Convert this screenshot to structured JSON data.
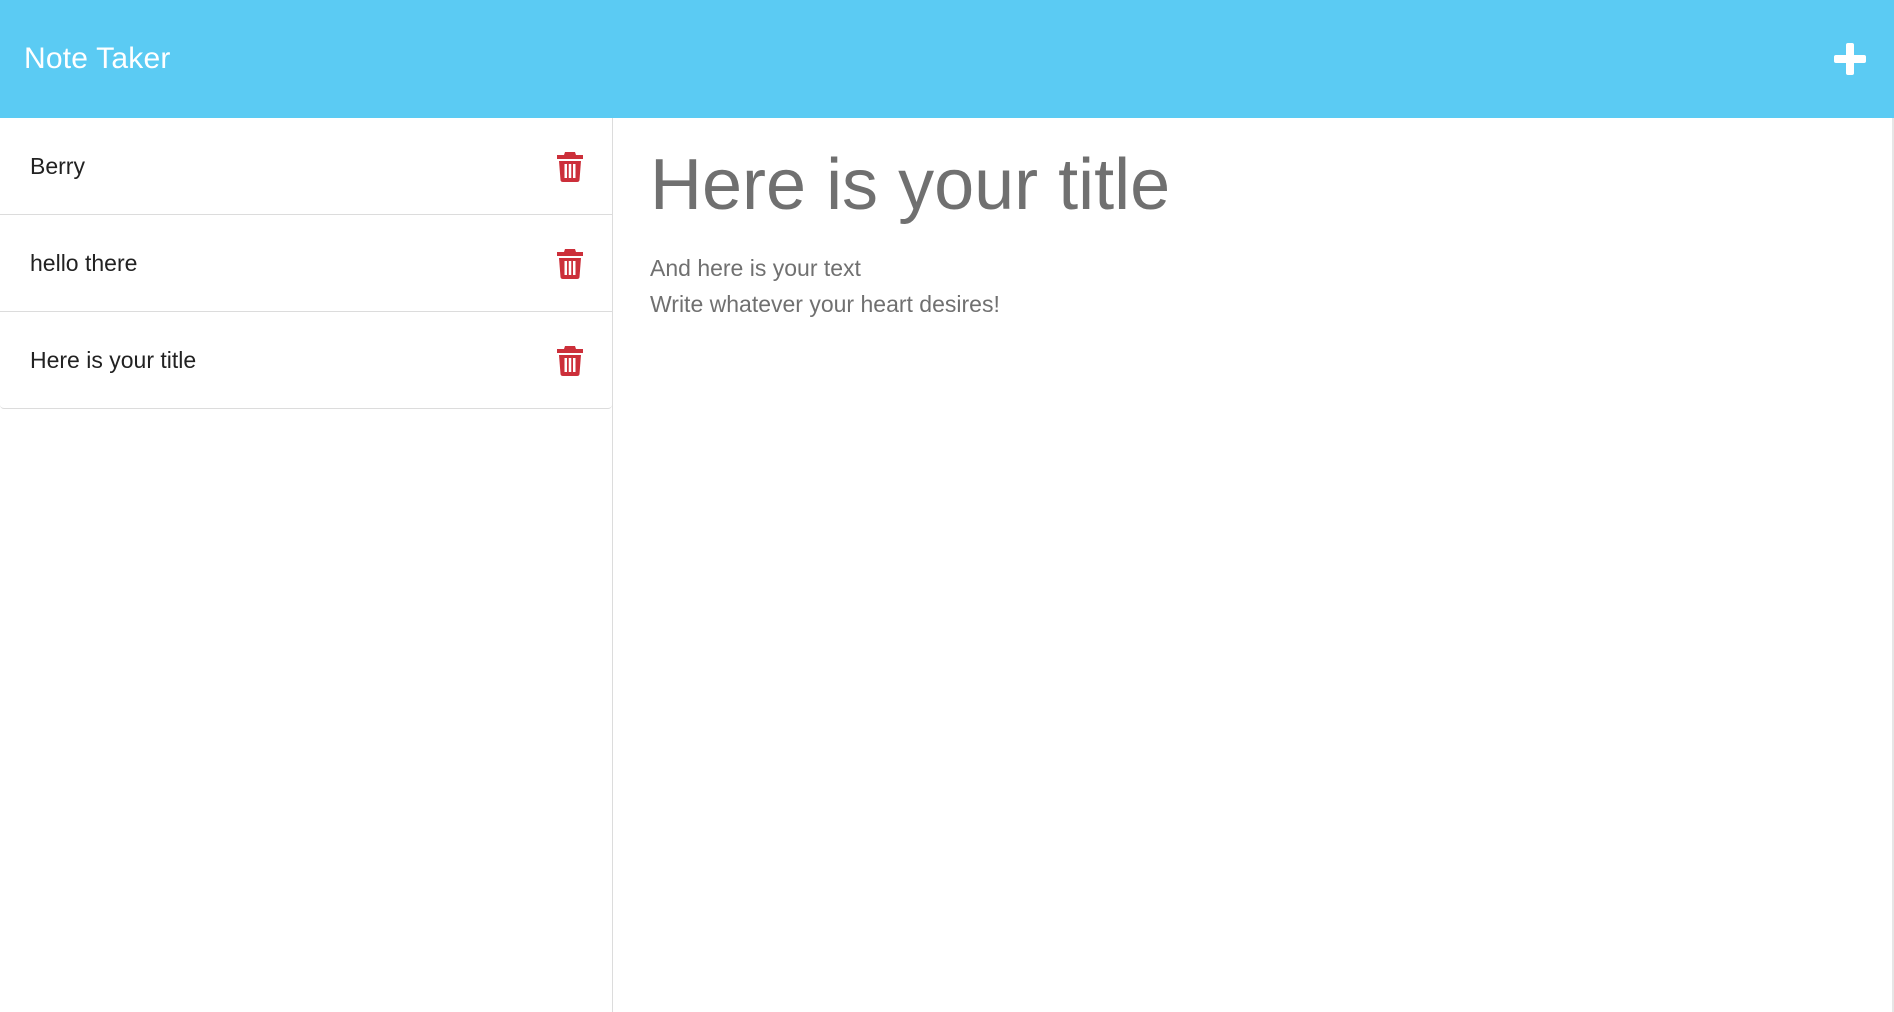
{
  "app": {
    "title": "Note Taker",
    "accent_color": "#5bcbf3",
    "new_note_icon": "plus-icon"
  },
  "notes": [
    {
      "title": "Berry",
      "delete_icon": "trash-icon"
    },
    {
      "title": "hello there",
      "delete_icon": "trash-icon"
    },
    {
      "title": "Here is your title",
      "delete_icon": "trash-icon"
    }
  ],
  "editor": {
    "title_placeholder": "Here is your title",
    "text_placeholder": "And here is your text\nWrite whatever your heart desires!"
  },
  "colors": {
    "delete": "#cc2f3a",
    "placeholder": "#707070"
  }
}
